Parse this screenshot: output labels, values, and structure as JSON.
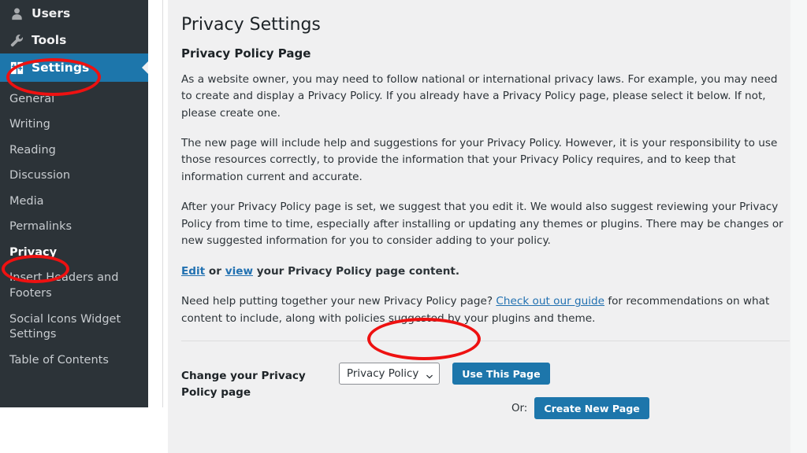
{
  "sidebar": {
    "top_items": [
      {
        "label": "Users",
        "icon": "user-icon",
        "current": false
      },
      {
        "label": "Tools",
        "icon": "wrench-icon",
        "current": false
      },
      {
        "label": "Settings",
        "icon": "settings-icon",
        "current": true
      }
    ],
    "submenu": [
      {
        "label": "General",
        "current": false
      },
      {
        "label": "Writing",
        "current": false
      },
      {
        "label": "Reading",
        "current": false
      },
      {
        "label": "Discussion",
        "current": false
      },
      {
        "label": "Media",
        "current": false
      },
      {
        "label": "Permalinks",
        "current": false
      },
      {
        "label": "Privacy",
        "current": true
      },
      {
        "label": "Insert Headers and Footers",
        "current": false
      },
      {
        "label": "Social Icons Widget Settings",
        "current": false
      },
      {
        "label": "Table of Contents",
        "current": false
      }
    ]
  },
  "main": {
    "page_title": "Privacy Settings",
    "section_title": "Privacy Policy Page",
    "paragraph_1": "As a website owner, you may need to follow national or international privacy laws. For example, you may need to create and display a Privacy Policy. If you already have a Privacy Policy page, please select it below. If not, please create one.",
    "paragraph_2": "The new page will include help and suggestions for your Privacy Policy. However, it is your responsibility to use those resources correctly, to provide the information that your Privacy Policy requires, and to keep that information current and accurate.",
    "paragraph_3": "After your Privacy Policy page is set, we suggest that you edit it. We would also suggest reviewing your Privacy Policy from time to time, especially after installing or updating any themes or plugins. There may be changes or new suggested information for you to consider adding to your policy.",
    "edit_view_line": {
      "edit_link": "Edit",
      "or_text": " or ",
      "view_link": "view",
      "tail_text": " your Privacy Policy page content."
    },
    "help_line": {
      "lead": "Need help putting together your new Privacy Policy page? ",
      "guide_link": "Check out our guide",
      "tail": " for recommendations on what content to include, along with policies suggested by your plugins and theme."
    },
    "form": {
      "label": "Change your Privacy Policy page",
      "select_value": "Privacy Policy",
      "select_options": [
        "Privacy Policy"
      ],
      "use_this_page_button": "Use This Page",
      "or_label": "Or:",
      "create_new_page_button": "Create New Page"
    }
  },
  "annotations": {
    "color": "#ee1111",
    "shapes": [
      {
        "name": "settings-menu-highlight",
        "target": "Settings"
      },
      {
        "name": "privacy-submenu-highlight",
        "target": "Privacy"
      },
      {
        "name": "create-new-page-highlight",
        "target": "Create New Page"
      }
    ]
  },
  "colors": {
    "sidebar_bg": "#2c3338",
    "active_menu_bg": "#1d76ab",
    "content_bg": "#f0f0f1",
    "button_bg": "#1d76ab",
    "link": "#2271b1",
    "annotation": "#ee1111"
  }
}
